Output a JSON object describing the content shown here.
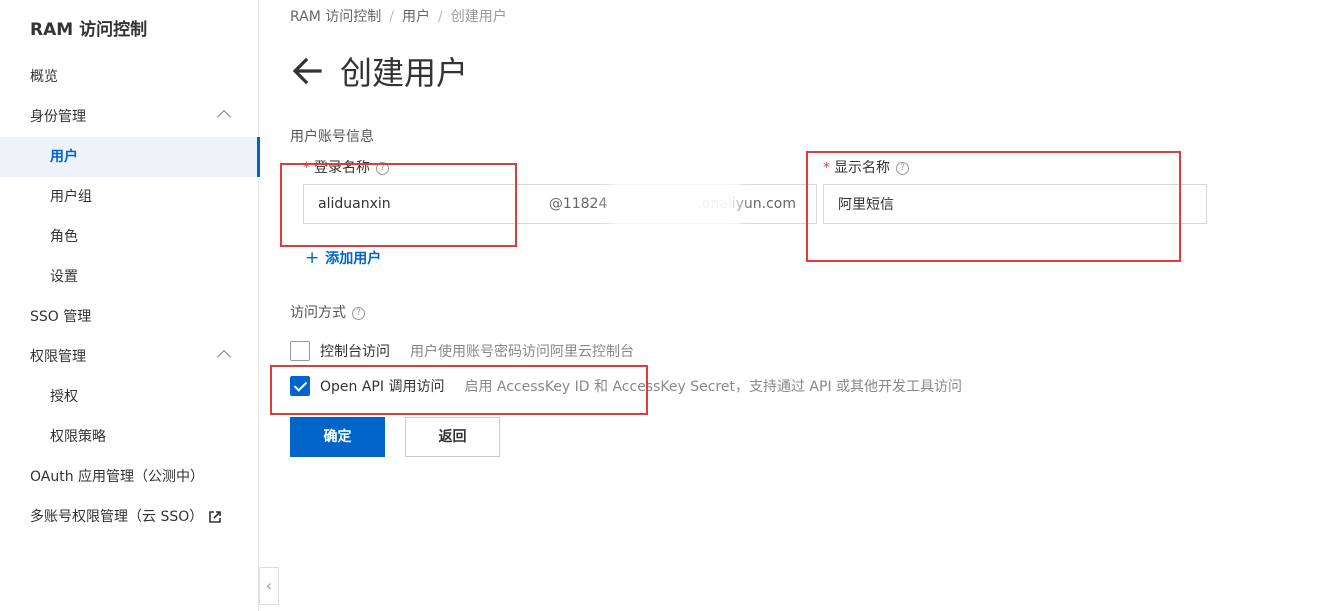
{
  "sidebar": {
    "title": "RAM 访问控制",
    "items": [
      {
        "label": "概览"
      },
      {
        "label": "身份管理"
      },
      {
        "label": "用户"
      },
      {
        "label": "用户组"
      },
      {
        "label": "角色"
      },
      {
        "label": "设置"
      },
      {
        "label": "SSO 管理"
      },
      {
        "label": "权限管理"
      },
      {
        "label": "授权"
      },
      {
        "label": "权限策略"
      },
      {
        "label": "OAuth 应用管理（公测中）"
      },
      {
        "label": "多账号权限管理（云 SSO）"
      }
    ],
    "active_item": "用户",
    "collapse_icon": "chevron-left-icon"
  },
  "breadcrumb": [
    "RAM 访问控制",
    "用户",
    "创建用户"
  ],
  "breadcrumb_separator": "/",
  "page_title": "创建用户",
  "form": {
    "section_account": "用户账号信息",
    "login_name_label": "登录名称",
    "login_name_value": "aliduanxin",
    "login_name_suffix": "@11824",
    "login_name_domain": ".onaliyun.com",
    "display_name_label": "显示名称",
    "display_name_value": "阿里短信",
    "required_mark": "*",
    "help_mark": "?",
    "add_user_plus": "+",
    "add_user_label": "添加用户",
    "section_access": "访问方式",
    "console_access_label": "控制台访问",
    "console_access_desc": "用户使用账号密码访问阿里云控制台",
    "console_access_checked": false,
    "api_access_label": "Open API 调用访问",
    "api_access_desc": "启用 AccessKey ID 和 AccessKey Secret，支持通过 API 或其他开发工具访问",
    "api_access_checked": true
  },
  "buttons": {
    "confirm": "确定",
    "back": "返回"
  },
  "colors": {
    "primary": "#0064c8",
    "highlight_box": "#e03c3c",
    "required": "#e54545"
  }
}
